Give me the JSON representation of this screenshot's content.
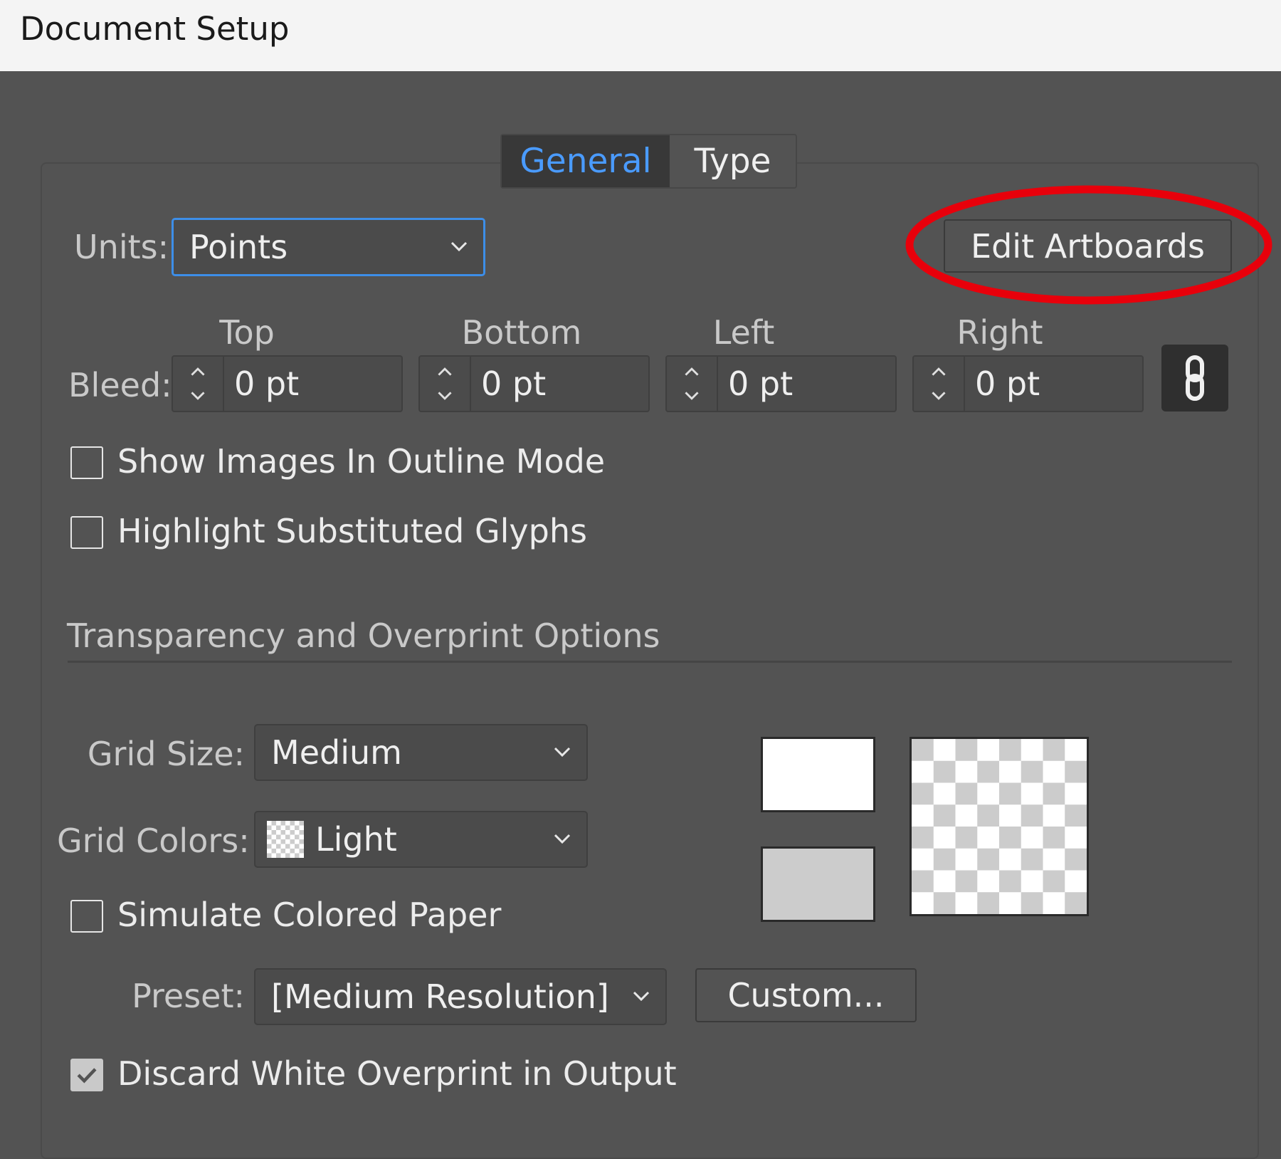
{
  "window": {
    "title": "Document Setup"
  },
  "tabs": [
    {
      "label": "General",
      "active": true
    },
    {
      "label": "Type",
      "active": false
    }
  ],
  "units": {
    "label": "Units:",
    "value": "Points"
  },
  "edit_artboards": {
    "label": "Edit Artboards",
    "highlight_color": "#e8000b"
  },
  "bleed": {
    "label": "Bleed:",
    "fields": [
      {
        "label": "Top",
        "value": "0 pt"
      },
      {
        "label": "Bottom",
        "value": "0 pt"
      },
      {
        "label": "Left",
        "value": "0 pt"
      },
      {
        "label": "Right",
        "value": "0 pt"
      }
    ],
    "link_icon": "chain-link-icon"
  },
  "checkboxes": {
    "show_images": {
      "label": "Show Images In Outline Mode",
      "checked": false
    },
    "highlight_glyphs": {
      "label": "Highlight Substituted Glyphs",
      "checked": false
    },
    "simulate_paper": {
      "label": "Simulate Colored Paper",
      "checked": false
    },
    "discard_white": {
      "label": "Discard White Overprint in Output",
      "checked": true
    }
  },
  "transparency": {
    "section_title": "Transparency and Overprint Options",
    "grid_size": {
      "label": "Grid Size:",
      "value": "Medium"
    },
    "grid_colors": {
      "label": "Grid Colors:",
      "value": "Light"
    },
    "preset": {
      "label": "Preset:",
      "value": "[Medium Resolution]"
    },
    "custom_button": "Custom...",
    "swatch_colors": {
      "top": "#ffffff",
      "bottom": "#cccccc",
      "grid_light": "#ffffff",
      "grid_dark": "#cccccc"
    }
  },
  "colors": {
    "accent": "#4a9bff",
    "dialog_bg": "#535353",
    "focus_border": "#3d8ee8"
  }
}
